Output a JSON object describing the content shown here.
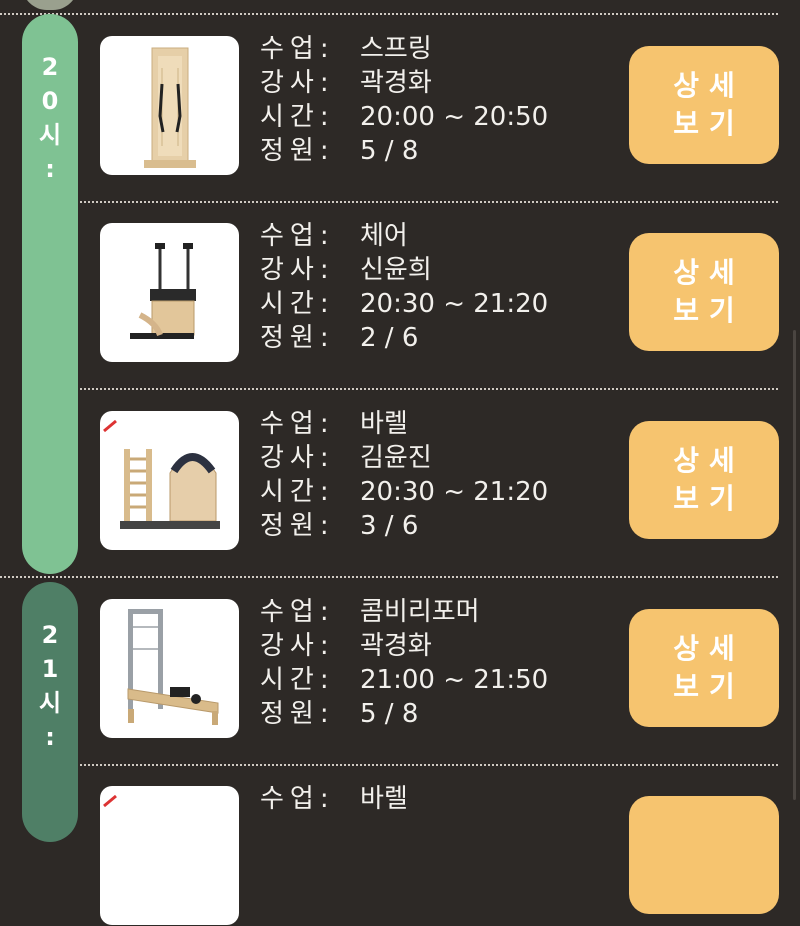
{
  "labels": {
    "class": "수업:",
    "instructor": "강사:",
    "time": "시간:",
    "capacity": "정원:"
  },
  "button": {
    "line1": "상세",
    "line2": "보기"
  },
  "hours": [
    {
      "chars": [
        "2",
        "0",
        "시",
        ":"
      ]
    },
    {
      "chars": [
        "2",
        "1",
        "시",
        ":"
      ]
    }
  ],
  "classes": [
    {
      "name": "스프링",
      "instructor": "곽경화",
      "time": "20:00 ~ 20:50",
      "capacity": "5 / 8",
      "icon": "spring-board-icon"
    },
    {
      "name": "체어",
      "instructor": "신윤희",
      "time": "20:30 ~ 21:20",
      "capacity": "2 / 6",
      "icon": "pilates-chair-icon"
    },
    {
      "name": "바렐",
      "instructor": "김윤진",
      "time": "20:30 ~ 21:20",
      "capacity": "3 / 6",
      "icon": "ladder-barrel-icon"
    },
    {
      "name": "콤비리포머",
      "instructor": "곽경화",
      "time": "21:00 ~ 21:50",
      "capacity": "5 / 8",
      "icon": "combo-reformer-icon"
    },
    {
      "name": "바렐",
      "instructor": "",
      "time": "",
      "capacity": "",
      "icon": "ladder-barrel-icon"
    }
  ],
  "colors": {
    "background": "#2d2926",
    "hour20": "#7fc293",
    "hour21": "#4f7f66",
    "button": "#f6c46f"
  }
}
